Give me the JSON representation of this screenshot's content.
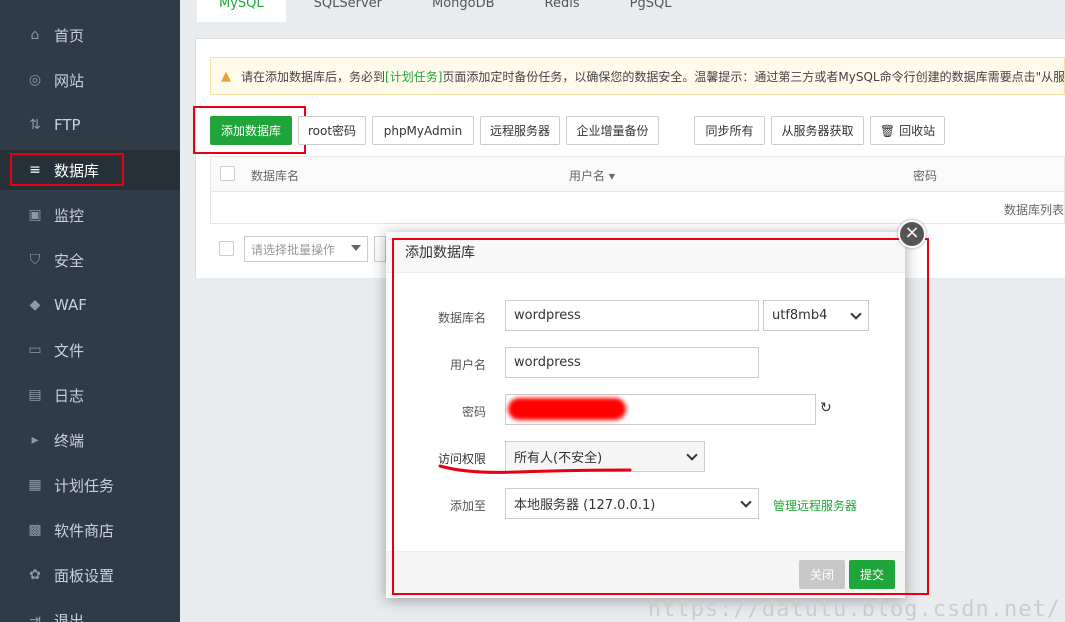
{
  "sidebar": {
    "items": [
      {
        "label": "首页",
        "icon": "home-icon",
        "glyph": "⌂"
      },
      {
        "label": "网站",
        "icon": "globe-icon",
        "glyph": "◎"
      },
      {
        "label": "FTP",
        "icon": "ftp-icon",
        "glyph": "⇅"
      },
      {
        "label": "数据库",
        "icon": "database-icon",
        "glyph": "≡"
      },
      {
        "label": "监控",
        "icon": "monitor-icon",
        "glyph": "▣"
      },
      {
        "label": "安全",
        "icon": "shield-icon",
        "glyph": "⛉"
      },
      {
        "label": "WAF",
        "icon": "waf-shield-icon",
        "glyph": "◆"
      },
      {
        "label": "文件",
        "icon": "folder-icon",
        "glyph": "▭"
      },
      {
        "label": "日志",
        "icon": "log-icon",
        "glyph": "▤"
      },
      {
        "label": "终端",
        "icon": "terminal-icon",
        "glyph": "▸"
      },
      {
        "label": "计划任务",
        "icon": "calendar-icon",
        "glyph": "▦"
      },
      {
        "label": "软件商店",
        "icon": "apps-icon",
        "glyph": "▩"
      },
      {
        "label": "面板设置",
        "icon": "gear-icon",
        "glyph": "✿"
      },
      {
        "label": "退出",
        "icon": "logout-icon",
        "glyph": "⇥"
      }
    ],
    "active_index": 3
  },
  "tabs": [
    "MySQL",
    "SQLServer",
    "MongoDB",
    "Redis",
    "PgSQL"
  ],
  "warning": {
    "before": "请在添加数据库后，务必到",
    "link": "[计划任务]",
    "after": "页面添加定时备份任务，以确保您的数据安全。温馨提示：通过第三方或者MySQL命令行创建的数据库需要点击\"从服"
  },
  "toolbar": {
    "add_db": "添加数据库",
    "root_pw": "root密码",
    "phpmyadmin": "phpMyAdmin",
    "remote_server": "远程服务器",
    "enterprise_backup": "企业增量备份",
    "sync_all": "同步所有",
    "fetch_from_server": "从服务器获取",
    "recycle_bin": "回收站"
  },
  "table": {
    "col_name": "数据库名",
    "col_user": "用户名",
    "col_password": "密码",
    "empty_text": "数据库列表"
  },
  "bulk": {
    "placeholder": "请选择批量操作"
  },
  "modal": {
    "title": "添加数据库",
    "labels": {
      "db_name": "数据库名",
      "username": "用户名",
      "password": "密码",
      "access": "访问权限",
      "add_to": "添加至"
    },
    "values": {
      "db_name": "wordpress",
      "charset": "utf8mb4",
      "username": "wordpress",
      "access": "所有人(不安全)",
      "add_to": "本地服务器 (127.0.0.1)"
    },
    "manage_remote": "管理远程服务器",
    "close": "关闭",
    "submit": "提交",
    "close_glyph": "×"
  },
  "watermark": "https://datutu.blog.csdn.net/",
  "colors": {
    "accent": "#20a53a",
    "annotation": "#e60012",
    "sidebar": "#2f3c46"
  }
}
